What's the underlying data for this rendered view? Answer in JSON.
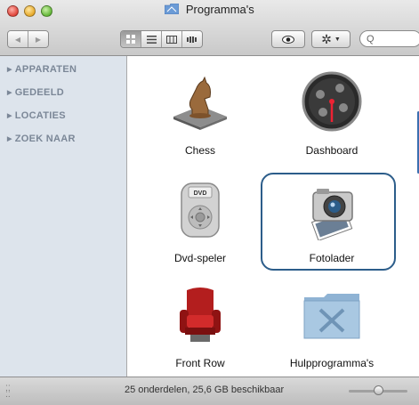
{
  "window": {
    "title": "Programma's"
  },
  "toolbar": {
    "nav": [
      "◀",
      "▶"
    ],
    "view_modes": [
      "icon-view",
      "list-view",
      "column-view",
      "coverflow-view"
    ],
    "quicklook_icon": "eye-icon",
    "action_icon": "gear-icon",
    "search_placeholder": ""
  },
  "sidebar": {
    "items": [
      {
        "label": "APPARATEN"
      },
      {
        "label": "GEDEELD"
      },
      {
        "label": "LOCATIES"
      },
      {
        "label": "ZOEK NAAR"
      }
    ]
  },
  "apps": [
    {
      "label": "Chess",
      "icon": "chess-knight-icon"
    },
    {
      "label": "Dashboard",
      "icon": "dashboard-gauge-icon"
    },
    {
      "label": "Dvd-speler",
      "icon": "dvd-remote-icon"
    },
    {
      "label": "Fotolader",
      "icon": "camera-icon"
    },
    {
      "label": "Front Row",
      "icon": "red-armchair-icon"
    },
    {
      "label": "Hulpprogramma's",
      "icon": "utilities-folder-icon"
    }
  ],
  "status": {
    "text": "25 onderdelen, 25,6 GB beschikbaar"
  },
  "colors": {
    "highlight": "#2c5d8a",
    "sidebar_bg": "#dde4ec"
  }
}
